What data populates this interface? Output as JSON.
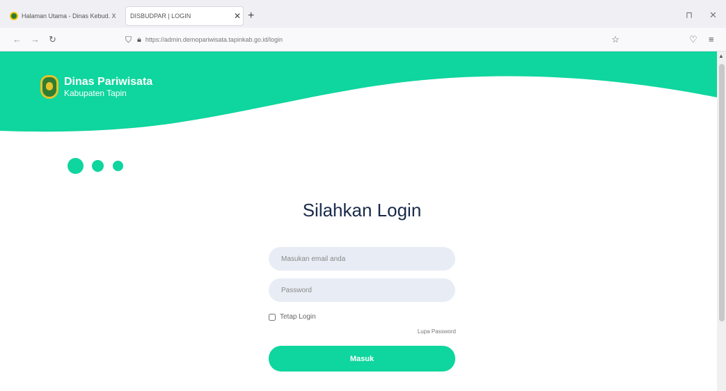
{
  "browser": {
    "tabs": [
      {
        "title": "Halaman Utama - Dinas Kebud. X",
        "active": false
      },
      {
        "title": "DISBUDPAR | LOGIN",
        "active": true
      }
    ],
    "url": "https://admin.demopariwisata.tapinkab.go.id/login",
    "icons": [
      "back-icon",
      "forward-icon",
      "reload-icon",
      "shield-icon",
      "lock-icon",
      "star-icon",
      "pocket-icon",
      "menu-icon"
    ]
  },
  "header": {
    "org_name": "Dinas Pariwisata",
    "org_sub": "Kabupaten Tapin"
  },
  "login": {
    "title": "Silahkan Login",
    "email_placeholder": "Masukan email anda",
    "password_placeholder": "Password",
    "remember_label": "Tetap Login",
    "forgot_label": "Lupa Password",
    "submit_label": "Masuk"
  },
  "colors": {
    "accent": "#0fd59e",
    "heading": "#1a2a4a",
    "input_bg": "#e8edf5"
  }
}
